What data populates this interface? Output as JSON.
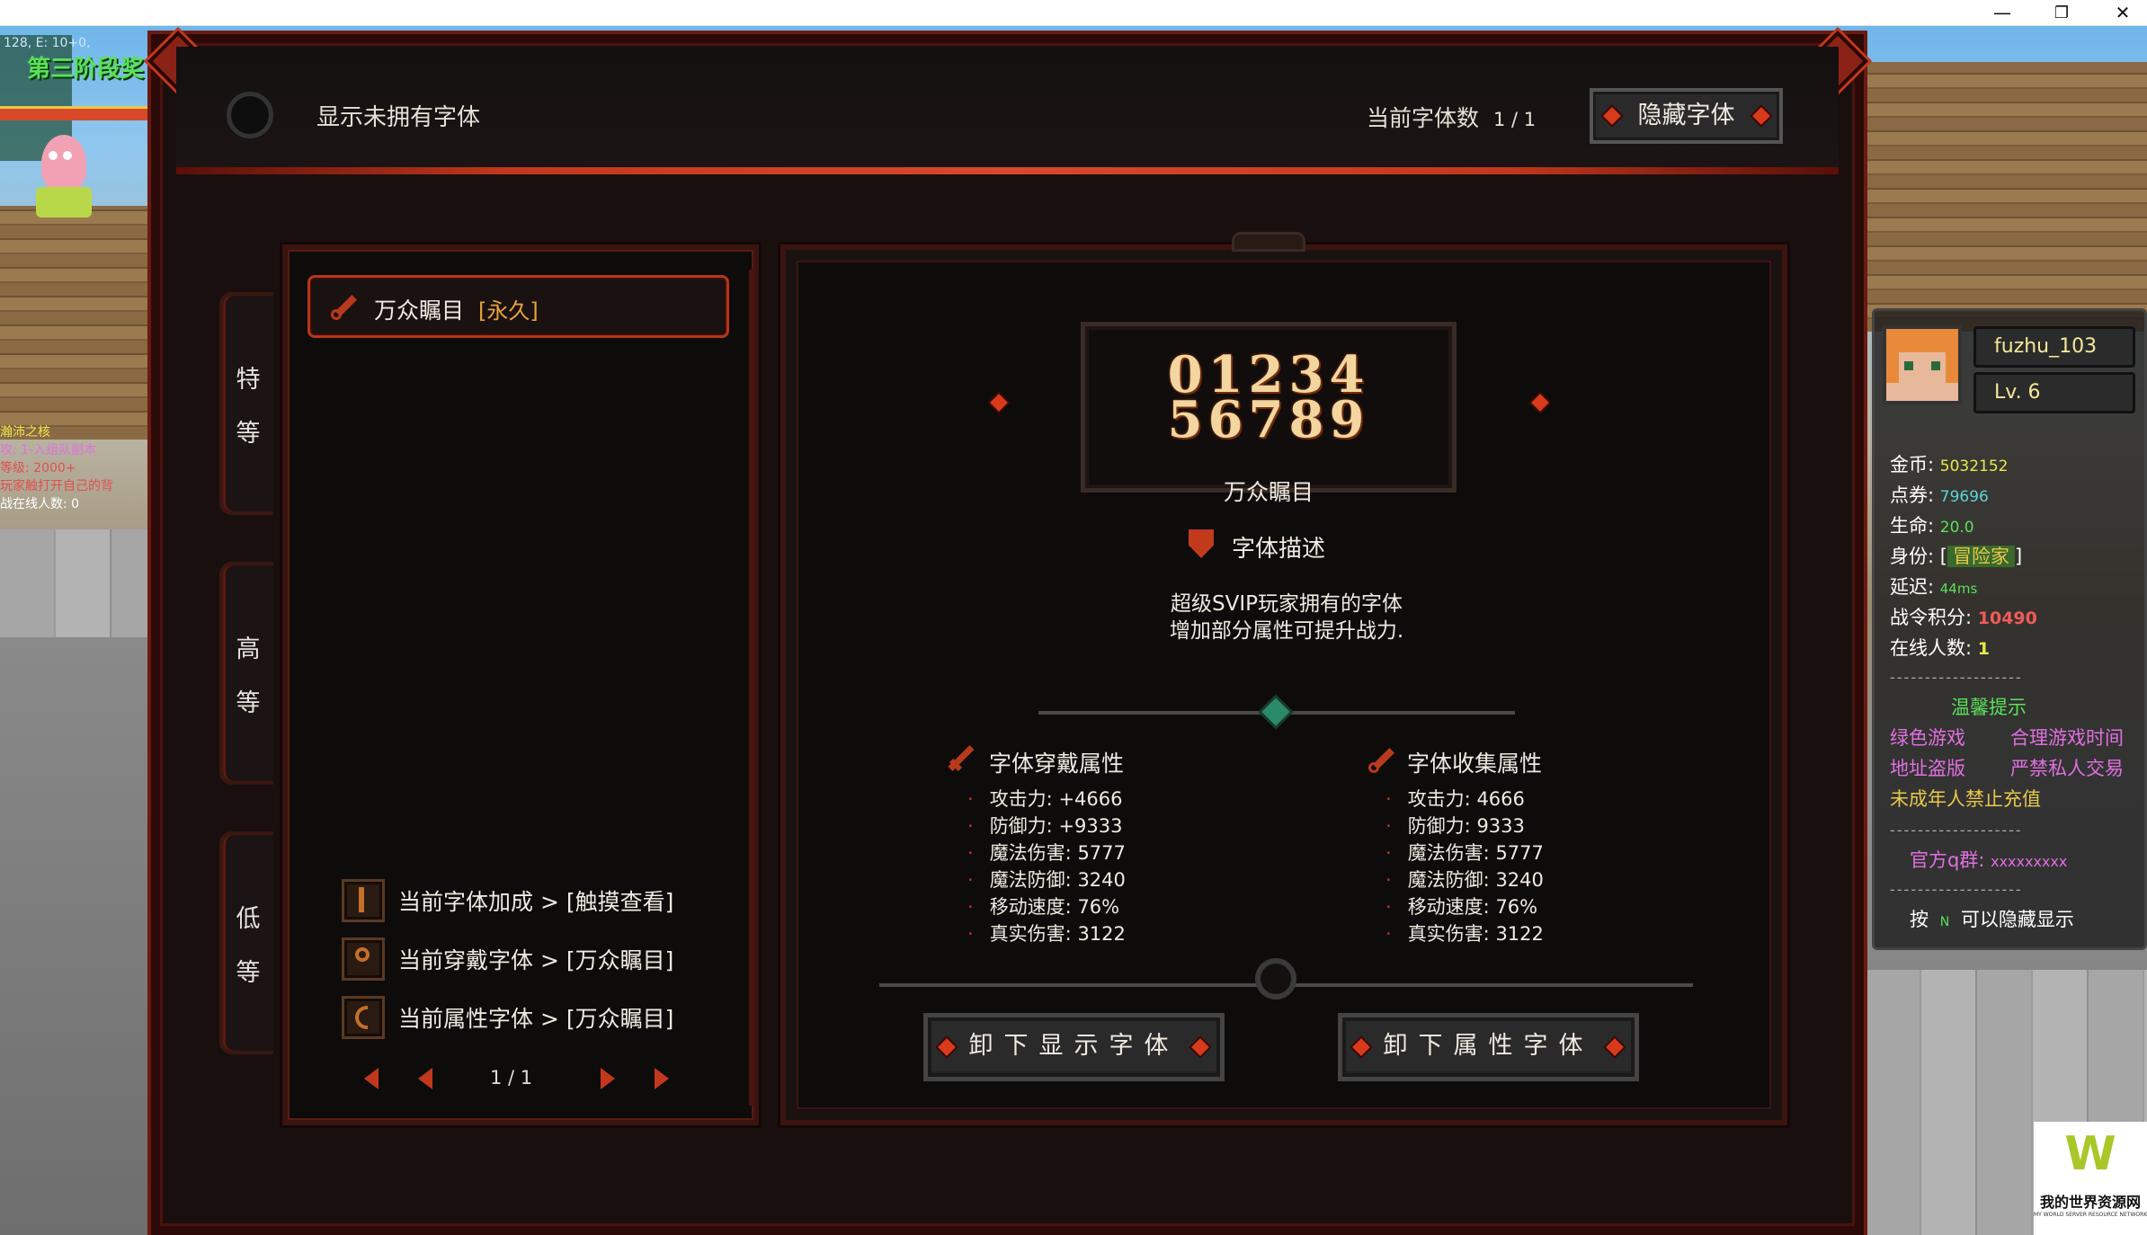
{
  "window": {
    "minimize": "—",
    "restore": "❐",
    "close": "✕"
  },
  "hud_left": {
    "coords": "128, E: 10+0,",
    "stage_banner": "第三阶段奖",
    "lines": [
      {
        "text": "瀚沛之核",
        "color": "#e8e84a"
      },
      {
        "text": "攻: 1-入组队副本",
        "color": "#e070e0"
      },
      {
        "text": "等级: 2000+",
        "color": "#e05050"
      },
      {
        "text": "玩家触打开自己的背",
        "color": "#e05050"
      },
      {
        "text": "战在线人数: 0",
        "color": "#ffffff"
      }
    ]
  },
  "header": {
    "show_unowned_label": "显示未拥有字体",
    "count_label": "当前字体数",
    "count_value": "1 / 1",
    "hide_button": "隐藏字体"
  },
  "tabs": [
    {
      "label": "特等"
    },
    {
      "label": "高等"
    },
    {
      "label": "低等"
    }
  ],
  "list": {
    "item_name": "万众瞩目",
    "item_tag": "[永久]",
    "status": [
      {
        "label": "当前字体加成 > [触摸查看]"
      },
      {
        "label": "当前穿戴字体 > [万众瞩目]"
      },
      {
        "label": "当前属性字体 > [万众瞩目]"
      }
    ],
    "page": "1 / 1"
  },
  "detail": {
    "preview_line1": "01234",
    "preview_line2": "56789",
    "font_name": "万众瞩目",
    "desc_title": "字体描述",
    "desc_line1": "超级SVIP玩家拥有的字体",
    "desc_line2": "增加部分属性可提升战力.",
    "wear_title": "字体穿戴属性",
    "collect_title": "字体收集属性",
    "wear_attrs": [
      "攻击力: +4666",
      "防御力: +9333",
      "魔法伤害: 5777",
      "魔法防御: 3240",
      "移动速度: 76%",
      "真实伤害: 3122"
    ],
    "collect_attrs": [
      "攻击力: 4666",
      "防御力: 9333",
      "魔法伤害: 5777",
      "魔法防御: 3240",
      "移动速度: 76%",
      "真实伤害: 3122"
    ],
    "unequip_display_button": "卸下显示字体",
    "unequip_attr_button": "卸下属性字体"
  },
  "sidebar": {
    "player_name": "fuzhu_103",
    "level": "Lv. 6",
    "gold_label": "金币:",
    "gold_value": "5032152",
    "points_label": "点券:",
    "points_value": "79696",
    "life_label": "生命:",
    "life_value": "20.0",
    "identity_label": "身份:",
    "identity_value": "冒险家",
    "latency_label": "延迟:",
    "latency_value": "44ms",
    "battle_label": "战令积分:",
    "battle_value": "10490",
    "online_label": "在线人数:",
    "online_value": "1",
    "separator": "-------------------",
    "tips_title": "温馨提示",
    "tip1": "绿色游戏",
    "tip2": "合理游戏时间",
    "tip3": "地址盗版",
    "tip4": "严禁私人交易",
    "tip5": "未成年人禁止充值",
    "group_label": "官方q群:",
    "group_value": "xxxxxxxxx",
    "hint_pre": "按",
    "hint_key": "N",
    "hint_post": "可以隐藏显示"
  },
  "watermark": {
    "logo_letter": "W",
    "text": "我的世界资源网",
    "subtext": "MY WORLD SERVER RESOURCE NETWORK"
  },
  "colors": {
    "accent": "#c2381c",
    "gold": "#e6a43a",
    "cyan": "#5ad6d6",
    "panel": "#0e0b0b"
  }
}
